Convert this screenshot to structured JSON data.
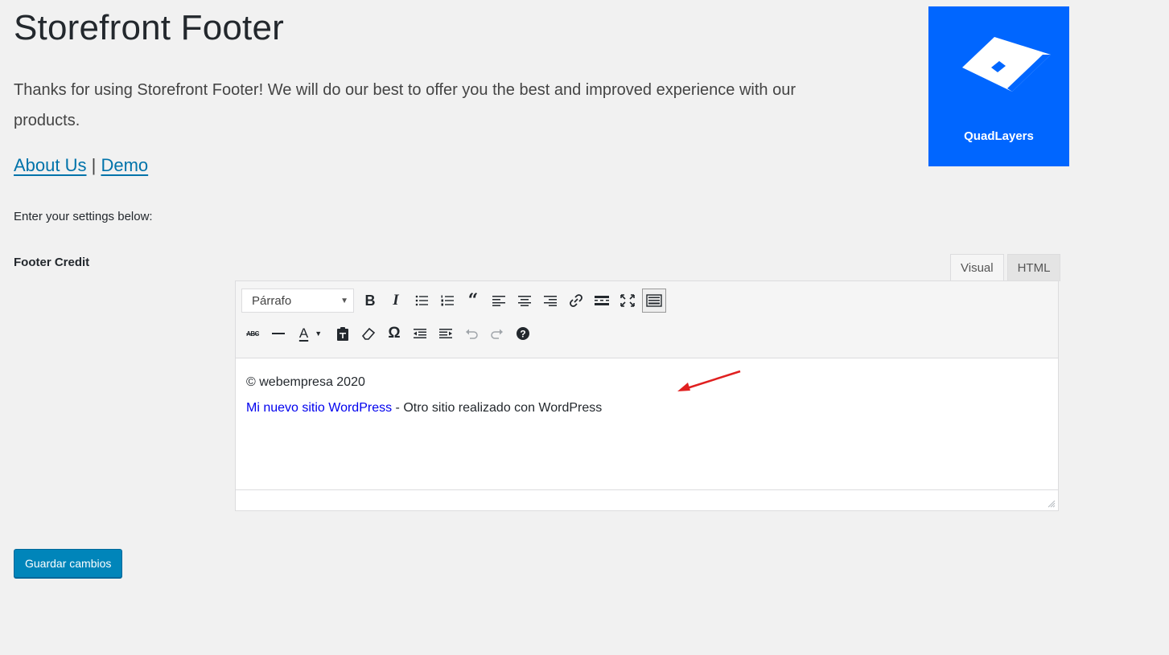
{
  "page": {
    "title": "Storefront Footer",
    "intro": "Thanks for using Storefront Footer! We will do our best to offer you the best and improved experience with our products.",
    "links": {
      "about": "About Us",
      "separator": "|",
      "demo": "Demo"
    },
    "settings_hint": "Enter your settings below:",
    "field_label": "Footer Credit"
  },
  "logo": {
    "brand": "QuadLayers",
    "bg": "#0066ff"
  },
  "editor": {
    "tabs": {
      "visual": "Visual",
      "html": "HTML",
      "active": "Visual"
    },
    "format_select": "Párrafo",
    "toolbar_row1": [
      "bold-icon",
      "italic-icon",
      "bullet-list-icon",
      "numbered-list-icon",
      "blockquote-icon",
      "align-left-icon",
      "align-center-icon",
      "align-right-icon",
      "link-icon",
      "read-more-icon",
      "fullscreen-icon",
      "toolbar-toggle-icon"
    ],
    "toolbar_row2": [
      "strikethrough-icon",
      "horizontal-line-icon",
      "text-color-icon",
      "paste-text-icon",
      "clear-formatting-icon",
      "special-character-icon",
      "outdent-icon",
      "indent-icon",
      "undo-icon",
      "redo-icon",
      "help-icon"
    ],
    "content": {
      "line1": "© webempresa 2020",
      "link_text": "Mi nuevo sitio WordPress",
      "rest": " - Otro sitio realizado con WordPress"
    }
  },
  "save_button": "Guardar cambios",
  "colors": {
    "accent": "#0073aa",
    "button": "#0085ba",
    "annotation_arrow": "#e02020"
  }
}
